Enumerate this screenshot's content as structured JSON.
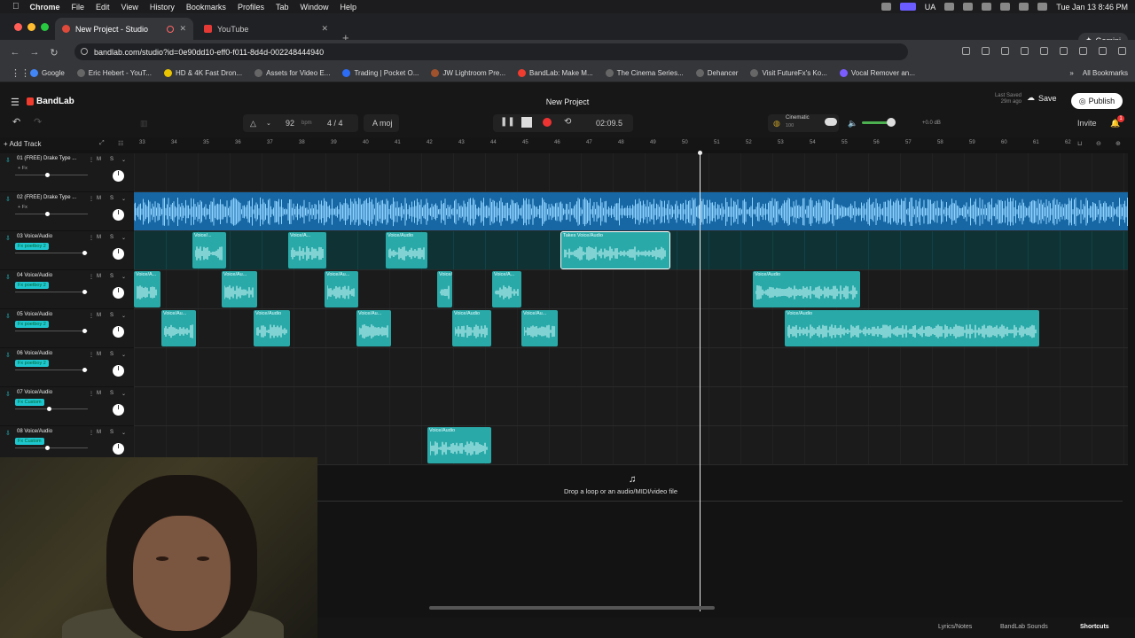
{
  "menubar": {
    "app": "Chrome",
    "items": [
      "File",
      "Edit",
      "View",
      "History",
      "Bookmarks",
      "Profiles",
      "Tab",
      "Window",
      "Help"
    ],
    "lang": "UA",
    "datetime": "Tue Jan 13  8:46 PM"
  },
  "tabs": [
    {
      "title": "New Project - Studio"
    },
    {
      "title": "YouTube"
    }
  ],
  "gemini": "Gemini",
  "url": "bandlab.com/studio?id=0e90dd10-eff0-f011-8d4d-002248444940",
  "bookmarks": [
    "Google",
    "Eric Hebert - YouT...",
    "HD & 4K Fast Dron...",
    "Assets for Video E...",
    "Trading | Pocket O...",
    "JW Lightroom Pre...",
    "BandLab: Make M...",
    "The Cinema Series...",
    "Dehancer",
    "Visit FutureFx's Ko...",
    "Vocal Remover an..."
  ],
  "all_bookmarks": "All Bookmarks",
  "app": {
    "brand": "BandLab",
    "project_title": "New Project",
    "last_saved_label": "Last Saved",
    "last_saved_time": "29m ago",
    "save": "Save",
    "publish": "Publish",
    "invite": "Invite",
    "notif_count": "1"
  },
  "toolbar": {
    "bpm": "92",
    "bpm_unit": "bpm",
    "time_sig": "4 / 4",
    "key": "A moj",
    "time": "02:09.5",
    "preset_name": "Cinematic",
    "preset_value": "100",
    "db": "+0.0 dB"
  },
  "add_track": "+ Add Track",
  "ruler": [
    "33",
    "34",
    "35",
    "36",
    "37",
    "38",
    "39",
    "40",
    "41",
    "42",
    "43",
    "44",
    "45",
    "46",
    "47",
    "48",
    "49",
    "50",
    "51",
    "52",
    "53",
    "54",
    "55",
    "56",
    "57",
    "58",
    "59",
    "60",
    "61",
    "62"
  ],
  "tracks": [
    {
      "num": "01",
      "name": "(FREE) Drake Type ...",
      "fx": "+ Fx",
      "fx_style": "plain",
      "vol": 0.45
    },
    {
      "num": "02",
      "name": "(FREE) Drake Type ...",
      "fx": "+ Fx",
      "fx_style": "plain",
      "vol": 0.45
    },
    {
      "num": "03",
      "name": "Voice/Audio",
      "fx": "Fx poetboy 2",
      "fx_style": "tag",
      "vol": 0.98
    },
    {
      "num": "04",
      "name": "Voice/Audio",
      "fx": "Fx poetboy 2",
      "fx_style": "tag",
      "vol": 0.98
    },
    {
      "num": "05",
      "name": "Voice/Audio",
      "fx": "Fx poetboy 2",
      "fx_style": "tag",
      "vol": 0.98
    },
    {
      "num": "06",
      "name": "Voice/Audio",
      "fx": "Fx poetboy 2",
      "fx_style": "tag",
      "vol": 0.98
    },
    {
      "num": "07",
      "name": "Voice/Audio",
      "fx": "Fx Custom",
      "fx_style": "tag",
      "vol": 0.48
    },
    {
      "num": "08",
      "name": "Voice/Audio",
      "fx": "Fx Custom",
      "fx_style": "tag",
      "vol": 0.45
    }
  ],
  "clips": {
    "t3": [
      "Voice/...",
      "Voice/A...",
      "Voice/Audio",
      "Takes",
      "Voice/Audio"
    ],
    "t4": [
      "Voice/A...",
      "Voice/Au...",
      "Voice/Au...",
      "Voice/A...",
      "Voice/Audio"
    ],
    "t5": [
      "Voice/Au...",
      "Voice/Audio",
      "Voice/Au...",
      "Voice/Audio",
      "Voice/Au...",
      "Voice/Audio"
    ],
    "t8": [
      "Voice/Audio"
    ]
  },
  "dropzone": "Drop a loop or an audio/MIDI/video file",
  "footer": {
    "lyrics": "Lyrics/Notes",
    "sounds": "BandLab Sounds",
    "shortcuts": "Shortcuts"
  },
  "colors": {
    "accent": "#1ec7cf",
    "clip": "#2aa9a9",
    "beat_lane": "#1767a4",
    "record": "#e33333",
    "brand": "#f03c2e"
  }
}
